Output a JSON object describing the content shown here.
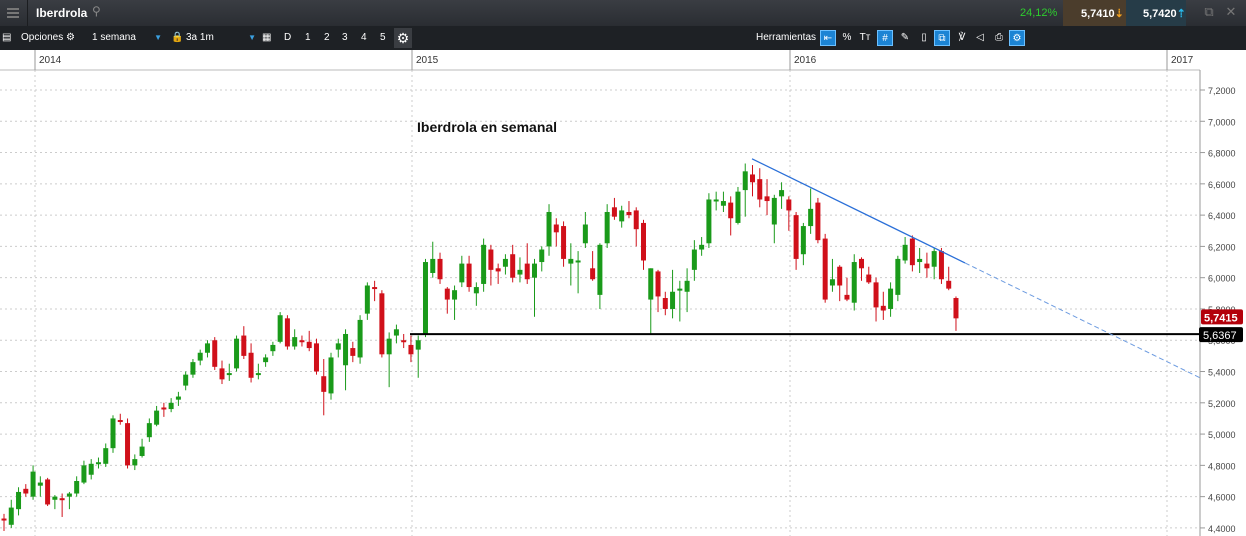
{
  "header": {
    "title": "Iberdrola",
    "change_pct": "24,12%",
    "sell_price": "5,7410",
    "buy_price": "5,7420",
    "sell_arrow_color": "#f0a020",
    "buy_arrow_color": "#29b7e8"
  },
  "toolbar": {
    "options_label": "Opciones",
    "interval": "1 semana",
    "range": "3a 1m",
    "period_buttons": [
      "D",
      "1",
      "2",
      "3",
      "4",
      "5"
    ],
    "tools_label": "Herramientas",
    "tool_icons": [
      "left-arrow-icon",
      "percent-icon",
      "text-size-icon",
      "grid-icon",
      "draw-icon",
      "candle-icon",
      "layers-icon",
      "indicators-icon",
      "tag-icon",
      "print-icon",
      "settings-pen-icon"
    ]
  },
  "annotation": "Iberdrola en semanal",
  "chart_data": {
    "type": "candlestick",
    "title": "",
    "x_tick_labels": [
      "2014",
      "2015",
      "2016",
      "2017"
    ],
    "y_tick_labels": [
      "7,2000",
      "7,0000",
      "6,8000",
      "6,6000",
      "6,4000",
      "6,2000",
      "6,0000",
      "5,8000",
      "5,6000",
      "5,4000",
      "5,2000",
      "5,0000",
      "4,8000",
      "4,6000",
      "4,4000"
    ],
    "ylim": [
      4.4,
      7.2
    ],
    "grid": true,
    "colors": {
      "up": "#1a9a1a",
      "down": "#d0101a",
      "trendline": "#2a6fd8",
      "support": "#000000"
    },
    "last_price_label": "5,7415",
    "support_label": "5,6367",
    "support_level": 5.6387,
    "trendline_prices": {
      "start": 6.76,
      "end": 5.36
    },
    "ohlc": [
      [
        4.46,
        4.49,
        4.38,
        4.45
      ],
      [
        4.42,
        4.58,
        4.4,
        4.53
      ],
      [
        4.52,
        4.66,
        4.48,
        4.63
      ],
      [
        4.65,
        4.68,
        4.6,
        4.62
      ],
      [
        4.6,
        4.8,
        4.58,
        4.76
      ],
      [
        4.67,
        4.73,
        4.6,
        4.69
      ],
      [
        4.71,
        4.72,
        4.54,
        4.55
      ],
      [
        4.58,
        4.61,
        4.52,
        4.6
      ],
      [
        4.59,
        4.62,
        4.47,
        4.58
      ],
      [
        4.6,
        4.63,
        4.52,
        4.62
      ],
      [
        4.62,
        4.73,
        4.6,
        4.7
      ],
      [
        4.69,
        4.83,
        4.68,
        4.8
      ],
      [
        4.74,
        4.84,
        4.71,
        4.81
      ],
      [
        4.81,
        4.85,
        4.78,
        4.82
      ],
      [
        4.81,
        4.94,
        4.79,
        4.91
      ],
      [
        4.91,
        5.12,
        4.88,
        5.1
      ],
      [
        5.09,
        5.13,
        5.06,
        5.08
      ],
      [
        5.07,
        5.1,
        4.78,
        4.8
      ],
      [
        4.8,
        4.87,
        4.77,
        4.84
      ],
      [
        4.86,
        4.97,
        4.85,
        4.92
      ],
      [
        4.98,
        5.1,
        4.95,
        5.07
      ],
      [
        5.06,
        5.18,
        5.05,
        5.15
      ],
      [
        5.17,
        5.2,
        5.11,
        5.16
      ],
      [
        5.16,
        5.23,
        5.14,
        5.2
      ],
      [
        5.22,
        5.27,
        5.18,
        5.24
      ],
      [
        5.31,
        5.4,
        5.28,
        5.38
      ],
      [
        5.38,
        5.48,
        5.36,
        5.46
      ],
      [
        5.47,
        5.54,
        5.44,
        5.52
      ],
      [
        5.52,
        5.6,
        5.49,
        5.58
      ],
      [
        5.6,
        5.62,
        5.41,
        5.43
      ],
      [
        5.42,
        5.47,
        5.32,
        5.35
      ],
      [
        5.38,
        5.45,
        5.34,
        5.39
      ],
      [
        5.42,
        5.63,
        5.4,
        5.61
      ],
      [
        5.63,
        5.69,
        5.48,
        5.5
      ],
      [
        5.52,
        5.58,
        5.33,
        5.36
      ],
      [
        5.38,
        5.45,
        5.35,
        5.39
      ],
      [
        5.46,
        5.51,
        5.43,
        5.49
      ],
      [
        5.53,
        5.59,
        5.5,
        5.57
      ],
      [
        5.59,
        5.78,
        5.58,
        5.76
      ],
      [
        5.74,
        5.76,
        5.54,
        5.56
      ],
      [
        5.56,
        5.67,
        5.54,
        5.62
      ],
      [
        5.6,
        5.63,
        5.56,
        5.59
      ],
      [
        5.59,
        5.66,
        5.53,
        5.55
      ],
      [
        5.58,
        5.61,
        5.38,
        5.4
      ],
      [
        5.37,
        5.48,
        5.12,
        5.27
      ],
      [
        5.26,
        5.52,
        5.22,
        5.49
      ],
      [
        5.54,
        5.61,
        5.49,
        5.58
      ],
      [
        5.44,
        5.67,
        5.28,
        5.64
      ],
      [
        5.55,
        5.59,
        5.46,
        5.5
      ],
      [
        5.49,
        5.76,
        5.45,
        5.73
      ],
      [
        5.77,
        5.97,
        5.73,
        5.95
      ],
      [
        5.94,
        5.98,
        5.85,
        5.93
      ],
      [
        5.9,
        5.92,
        5.49,
        5.51
      ],
      [
        5.51,
        5.65,
        5.3,
        5.61
      ],
      [
        5.63,
        5.7,
        5.58,
        5.67
      ],
      [
        5.6,
        5.64,
        5.55,
        5.59
      ],
      [
        5.57,
        5.63,
        5.46,
        5.51
      ],
      [
        5.54,
        5.63,
        5.36,
        5.6
      ],
      [
        5.64,
        6.12,
        5.62,
        6.1
      ],
      [
        6.03,
        6.23,
        6.0,
        6.12
      ],
      [
        6.12,
        6.16,
        5.96,
        5.99
      ],
      [
        5.93,
        5.94,
        5.77,
        5.86
      ],
      [
        5.86,
        5.95,
        5.73,
        5.92
      ],
      [
        5.97,
        6.14,
        5.94,
        6.09
      ],
      [
        6.09,
        6.14,
        5.91,
        5.94
      ],
      [
        5.9,
        5.97,
        5.82,
        5.94
      ],
      [
        5.96,
        6.25,
        5.91,
        6.21
      ],
      [
        6.18,
        6.21,
        5.95,
        6.05
      ],
      [
        6.06,
        6.09,
        5.96,
        6.04
      ],
      [
        6.07,
        6.15,
        6.02,
        6.12
      ],
      [
        6.15,
        6.21,
        5.97,
        6.0
      ],
      [
        6.02,
        6.13,
        5.97,
        6.05
      ],
      [
        6.09,
        6.22,
        5.96,
        5.99
      ],
      [
        6.0,
        6.12,
        5.75,
        6.09
      ],
      [
        6.1,
        6.2,
        6.04,
        6.18
      ],
      [
        6.2,
        6.47,
        6.14,
        6.42
      ],
      [
        6.34,
        6.38,
        6.2,
        6.29
      ],
      [
        6.33,
        6.36,
        6.07,
        6.12
      ],
      [
        6.09,
        6.22,
        5.95,
        6.12
      ],
      [
        6.1,
        6.17,
        5.9,
        6.11
      ],
      [
        6.22,
        6.42,
        6.19,
        6.34
      ],
      [
        6.06,
        6.17,
        5.98,
        5.99
      ],
      [
        5.89,
        6.22,
        5.8,
        6.21
      ],
      [
        6.22,
        6.47,
        6.19,
        6.42
      ],
      [
        6.45,
        6.51,
        6.37,
        6.39
      ],
      [
        6.36,
        6.46,
        6.32,
        6.43
      ],
      [
        6.42,
        6.49,
        6.38,
        6.4
      ],
      [
        6.43,
        6.45,
        6.2,
        6.31
      ],
      [
        6.35,
        6.37,
        6.05,
        6.11
      ],
      [
        5.86,
        6.06,
        5.64,
        6.06
      ],
      [
        6.04,
        6.05,
        5.78,
        5.88
      ],
      [
        5.87,
        5.91,
        5.76,
        5.8
      ],
      [
        5.8,
        6.05,
        5.74,
        5.91
      ],
      [
        5.92,
        5.98,
        5.72,
        5.93
      ],
      [
        5.91,
        6.06,
        5.78,
        5.98
      ],
      [
        6.05,
        6.24,
        5.98,
        6.18
      ],
      [
        6.18,
        6.26,
        6.14,
        6.21
      ],
      [
        6.22,
        6.54,
        6.19,
        6.5
      ],
      [
        6.49,
        6.55,
        6.43,
        6.5
      ],
      [
        6.46,
        6.55,
        6.42,
        6.49
      ],
      [
        6.48,
        6.52,
        6.27,
        6.38
      ],
      [
        6.35,
        6.58,
        6.34,
        6.55
      ],
      [
        6.56,
        6.73,
        6.39,
        6.68
      ],
      [
        6.66,
        6.72,
        6.52,
        6.61
      ],
      [
        6.63,
        6.7,
        6.45,
        6.5
      ],
      [
        6.52,
        6.63,
        6.4,
        6.49
      ],
      [
        6.34,
        6.53,
        6.22,
        6.51
      ],
      [
        6.52,
        6.61,
        6.44,
        6.56
      ],
      [
        6.5,
        6.52,
        6.3,
        6.43
      ],
      [
        6.4,
        6.42,
        6.05,
        6.12
      ],
      [
        6.15,
        6.35,
        6.08,
        6.33
      ],
      [
        6.33,
        6.57,
        6.28,
        6.44
      ],
      [
        6.48,
        6.51,
        6.22,
        6.24
      ],
      [
        6.25,
        6.28,
        5.84,
        5.86
      ],
      [
        5.95,
        6.12,
        5.91,
        5.99
      ],
      [
        6.07,
        6.08,
        5.85,
        5.95
      ],
      [
        5.89,
        6.0,
        5.85,
        5.86
      ],
      [
        5.84,
        6.15,
        5.79,
        6.1
      ],
      [
        6.12,
        6.13,
        5.98,
        6.06
      ],
      [
        6.02,
        6.07,
        5.96,
        5.97
      ],
      [
        5.97,
        6.0,
        5.72,
        5.81
      ],
      [
        5.82,
        5.91,
        5.73,
        5.79
      ],
      [
        5.8,
        5.97,
        5.75,
        5.93
      ],
      [
        5.89,
        6.14,
        5.85,
        6.12
      ],
      [
        6.11,
        6.26,
        6.09,
        6.21
      ],
      [
        6.25,
        6.27,
        6.04,
        6.08
      ],
      [
        6.1,
        6.19,
        6.03,
        6.12
      ],
      [
        6.09,
        6.16,
        6.0,
        6.06
      ],
      [
        6.07,
        6.19,
        5.99,
        6.17
      ],
      [
        6.17,
        6.19,
        5.96,
        5.99
      ],
      [
        5.98,
        6.07,
        5.92,
        5.93
      ],
      [
        5.87,
        5.88,
        5.66,
        5.74
      ]
    ]
  }
}
